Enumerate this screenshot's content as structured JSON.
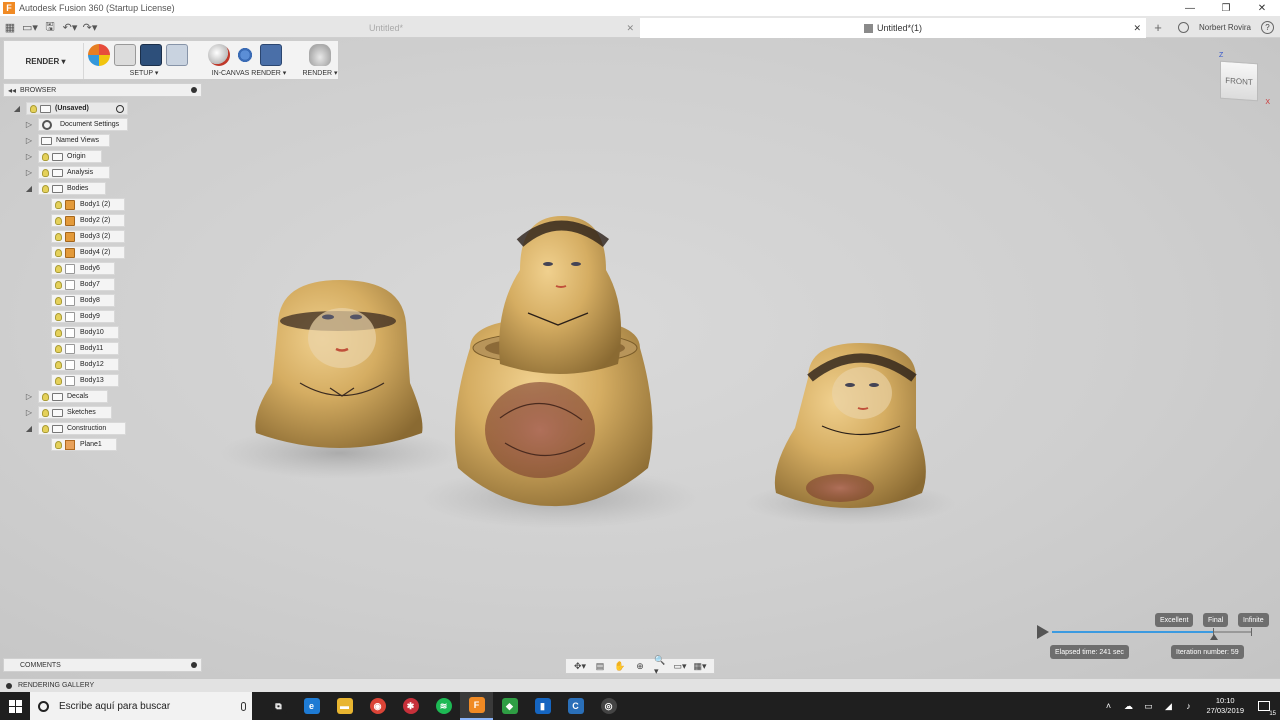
{
  "window": {
    "title": "Autodesk Fusion 360 (Startup License)",
    "app_logo": "F",
    "controls": [
      "—",
      "❐",
      "✕"
    ]
  },
  "tabs": {
    "inactive": {
      "label": "Untitled*"
    },
    "active": {
      "label": "Untitled*(1)"
    },
    "close_glyph": "✕",
    "new_tab_glyph": "+"
  },
  "user": {
    "name": "Norbert Rovira",
    "help_glyph": "?"
  },
  "quick_access": [
    "▦",
    "▭▾",
    "🖫",
    "↶▾",
    "↷▾"
  ],
  "toolbar": {
    "workspace": "RENDER ▾",
    "groups": [
      {
        "label": "SETUP ▾"
      },
      {
        "label": "IN-CANVAS RENDER ▾"
      },
      {
        "label": "RENDER ▾"
      }
    ]
  },
  "browser": {
    "title": "BROWSER",
    "collapse_glyph": "◂◂",
    "root": "(Unsaved)",
    "items": [
      {
        "label": "Document Settings"
      },
      {
        "label": "Named Views"
      },
      {
        "label": "Origin"
      },
      {
        "label": "Analysis"
      },
      {
        "label": "Bodies"
      },
      {
        "label": "Body1 (2)"
      },
      {
        "label": "Body2 (2)"
      },
      {
        "label": "Body3 (2)"
      },
      {
        "label": "Body4 (2)"
      },
      {
        "label": "Body6"
      },
      {
        "label": "Body7"
      },
      {
        "label": "Body8"
      },
      {
        "label": "Body9"
      },
      {
        "label": "Body10"
      },
      {
        "label": "Body11"
      },
      {
        "label": "Body12"
      },
      {
        "label": "Body13"
      },
      {
        "label": "Decals"
      },
      {
        "label": "Sketches"
      },
      {
        "label": "Construction"
      },
      {
        "label": "Plane1"
      }
    ],
    "expand_glyph": "▷",
    "expanded_glyph": "◢"
  },
  "viewcube": {
    "face": "FRONT",
    "z": "Z",
    "x": "X"
  },
  "render_progress": {
    "levels": [
      "Excellent",
      "Final",
      "Infinite"
    ],
    "progress_fraction": 0.81,
    "elapsed": "Elapsed time: 241 sec",
    "iteration": "Iteration number: 59"
  },
  "comments": {
    "title": "COMMENTS"
  },
  "navbar": [
    "✥▾",
    "▤",
    "✋",
    "⊕",
    "🔍▾",
    "▭▾",
    "▦▾"
  ],
  "gallery": {
    "title": "RENDERING GALLERY"
  },
  "taskbar": {
    "search_placeholder": "Escribe aquí para buscar",
    "apps": [
      {
        "glyph": "⧉",
        "color": "#1f1f1f"
      },
      {
        "glyph": "e",
        "color": "#1e7bd4"
      },
      {
        "glyph": "▬",
        "color": "#e8b530"
      },
      {
        "glyph": "◉",
        "color": "#db4437"
      },
      {
        "glyph": "✱",
        "color": "#c7303a"
      },
      {
        "glyph": "≋",
        "color": "#1db954"
      },
      {
        "glyph": "F",
        "color": "#f08a24"
      },
      {
        "glyph": "◆",
        "color": "#2f9e44"
      },
      {
        "glyph": "▮",
        "color": "#1565c0"
      },
      {
        "glyph": "C",
        "color": "#2a6fb8"
      },
      {
        "glyph": "◎",
        "color": "#444444"
      }
    ],
    "tray": [
      "˄",
      "☁",
      "▭",
      "◢",
      "♪"
    ],
    "time": "10:10",
    "date": "27/03/2019",
    "notification_count": "15"
  },
  "colors": {
    "accent": "#3b9ae0",
    "wood": "#d9b46a",
    "bulb": "#e5d15a"
  }
}
